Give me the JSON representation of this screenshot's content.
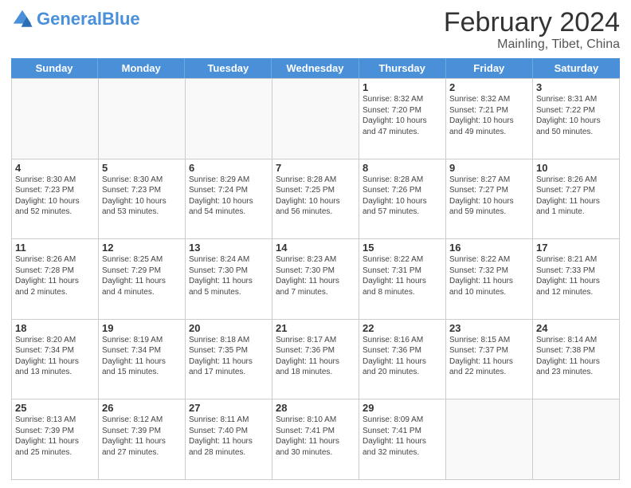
{
  "header": {
    "logo_general": "General",
    "logo_blue": "Blue",
    "month_title": "February 2024",
    "location": "Mainling, Tibet, China"
  },
  "weekdays": [
    "Sunday",
    "Monday",
    "Tuesday",
    "Wednesday",
    "Thursday",
    "Friday",
    "Saturday"
  ],
  "weeks": [
    [
      {
        "day": "",
        "info": ""
      },
      {
        "day": "",
        "info": ""
      },
      {
        "day": "",
        "info": ""
      },
      {
        "day": "",
        "info": ""
      },
      {
        "day": "1",
        "info": "Sunrise: 8:32 AM\nSunset: 7:20 PM\nDaylight: 10 hours\nand 47 minutes."
      },
      {
        "day": "2",
        "info": "Sunrise: 8:32 AM\nSunset: 7:21 PM\nDaylight: 10 hours\nand 49 minutes."
      },
      {
        "day": "3",
        "info": "Sunrise: 8:31 AM\nSunset: 7:22 PM\nDaylight: 10 hours\nand 50 minutes."
      }
    ],
    [
      {
        "day": "4",
        "info": "Sunrise: 8:30 AM\nSunset: 7:23 PM\nDaylight: 10 hours\nand 52 minutes."
      },
      {
        "day": "5",
        "info": "Sunrise: 8:30 AM\nSunset: 7:23 PM\nDaylight: 10 hours\nand 53 minutes."
      },
      {
        "day": "6",
        "info": "Sunrise: 8:29 AM\nSunset: 7:24 PM\nDaylight: 10 hours\nand 54 minutes."
      },
      {
        "day": "7",
        "info": "Sunrise: 8:28 AM\nSunset: 7:25 PM\nDaylight: 10 hours\nand 56 minutes."
      },
      {
        "day": "8",
        "info": "Sunrise: 8:28 AM\nSunset: 7:26 PM\nDaylight: 10 hours\nand 57 minutes."
      },
      {
        "day": "9",
        "info": "Sunrise: 8:27 AM\nSunset: 7:27 PM\nDaylight: 10 hours\nand 59 minutes."
      },
      {
        "day": "10",
        "info": "Sunrise: 8:26 AM\nSunset: 7:27 PM\nDaylight: 11 hours\nand 1 minute."
      }
    ],
    [
      {
        "day": "11",
        "info": "Sunrise: 8:26 AM\nSunset: 7:28 PM\nDaylight: 11 hours\nand 2 minutes."
      },
      {
        "day": "12",
        "info": "Sunrise: 8:25 AM\nSunset: 7:29 PM\nDaylight: 11 hours\nand 4 minutes."
      },
      {
        "day": "13",
        "info": "Sunrise: 8:24 AM\nSunset: 7:30 PM\nDaylight: 11 hours\nand 5 minutes."
      },
      {
        "day": "14",
        "info": "Sunrise: 8:23 AM\nSunset: 7:30 PM\nDaylight: 11 hours\nand 7 minutes."
      },
      {
        "day": "15",
        "info": "Sunrise: 8:22 AM\nSunset: 7:31 PM\nDaylight: 11 hours\nand 8 minutes."
      },
      {
        "day": "16",
        "info": "Sunrise: 8:22 AM\nSunset: 7:32 PM\nDaylight: 11 hours\nand 10 minutes."
      },
      {
        "day": "17",
        "info": "Sunrise: 8:21 AM\nSunset: 7:33 PM\nDaylight: 11 hours\nand 12 minutes."
      }
    ],
    [
      {
        "day": "18",
        "info": "Sunrise: 8:20 AM\nSunset: 7:34 PM\nDaylight: 11 hours\nand 13 minutes."
      },
      {
        "day": "19",
        "info": "Sunrise: 8:19 AM\nSunset: 7:34 PM\nDaylight: 11 hours\nand 15 minutes."
      },
      {
        "day": "20",
        "info": "Sunrise: 8:18 AM\nSunset: 7:35 PM\nDaylight: 11 hours\nand 17 minutes."
      },
      {
        "day": "21",
        "info": "Sunrise: 8:17 AM\nSunset: 7:36 PM\nDaylight: 11 hours\nand 18 minutes."
      },
      {
        "day": "22",
        "info": "Sunrise: 8:16 AM\nSunset: 7:36 PM\nDaylight: 11 hours\nand 20 minutes."
      },
      {
        "day": "23",
        "info": "Sunrise: 8:15 AM\nSunset: 7:37 PM\nDaylight: 11 hours\nand 22 minutes."
      },
      {
        "day": "24",
        "info": "Sunrise: 8:14 AM\nSunset: 7:38 PM\nDaylight: 11 hours\nand 23 minutes."
      }
    ],
    [
      {
        "day": "25",
        "info": "Sunrise: 8:13 AM\nSunset: 7:39 PM\nDaylight: 11 hours\nand 25 minutes."
      },
      {
        "day": "26",
        "info": "Sunrise: 8:12 AM\nSunset: 7:39 PM\nDaylight: 11 hours\nand 27 minutes."
      },
      {
        "day": "27",
        "info": "Sunrise: 8:11 AM\nSunset: 7:40 PM\nDaylight: 11 hours\nand 28 minutes."
      },
      {
        "day": "28",
        "info": "Sunrise: 8:10 AM\nSunset: 7:41 PM\nDaylight: 11 hours\nand 30 minutes."
      },
      {
        "day": "29",
        "info": "Sunrise: 8:09 AM\nSunset: 7:41 PM\nDaylight: 11 hours\nand 32 minutes."
      },
      {
        "day": "",
        "info": ""
      },
      {
        "day": "",
        "info": ""
      }
    ]
  ]
}
